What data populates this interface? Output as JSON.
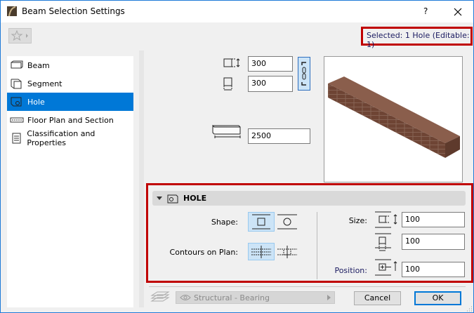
{
  "window": {
    "title": "Beam Selection Settings",
    "help": "?"
  },
  "status": {
    "selected": "Selected: 1 Hole (Editable: 1)"
  },
  "sidebar": {
    "items": [
      {
        "label": "Beam",
        "icon": "beam-icon"
      },
      {
        "label": "Segment",
        "icon": "segment-icon"
      },
      {
        "label": "Hole",
        "icon": "hole-icon",
        "selected": true
      },
      {
        "label": "Floor Plan and Section",
        "icon": "floor-plan-icon"
      },
      {
        "label": "Classification and Properties",
        "icon": "classification-icon"
      }
    ]
  },
  "geometry": {
    "height": "300",
    "width": "300",
    "length": "2500"
  },
  "hole": {
    "title": "HOLE",
    "shape_label": "Shape:",
    "contours_label": "Contours on Plan:",
    "size_label": "Size:",
    "position_label": "Position:",
    "size_height": "100",
    "size_width": "100",
    "position": "100"
  },
  "footer": {
    "layer": "Structural - Bearing",
    "cancel": "Cancel",
    "ok": "OK"
  },
  "colors": {
    "accent": "#0078d7",
    "highlight": "#c00000"
  }
}
